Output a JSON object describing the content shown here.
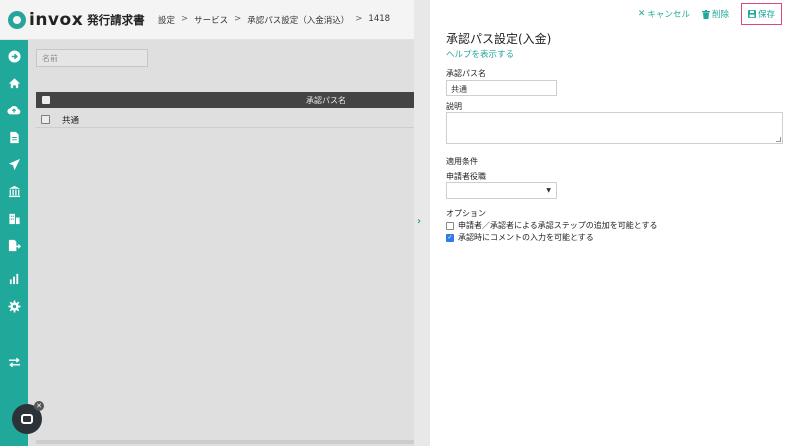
{
  "app": {
    "logo_text": "invox",
    "logo_sub": "発行請求書"
  },
  "breadcrumb": [
    "設定",
    "サービス",
    "承認パス設定（入金消込）",
    "1418"
  ],
  "breadcrumb_sep": ">",
  "sidebar": {
    "icons": [
      "arrow-right-icon",
      "home-icon",
      "cloud-upload-icon",
      "document-icon",
      "send-icon",
      "bank-icon",
      "building-icon",
      "export-icon",
      "chart-icon",
      "gear-icon",
      "transfer-icon"
    ]
  },
  "list": {
    "search_placeholder": "名前",
    "column_header": "承認パス名",
    "rows": [
      {
        "name": "共通"
      }
    ]
  },
  "panel": {
    "actions": {
      "cancel": "キャンセル",
      "delete": "削除",
      "save": "保存"
    },
    "title": "承認パス設定(入金)",
    "help_link": "ヘルプを表示する",
    "name_label": "承認パス名",
    "name_value": "共通",
    "description_label": "説明",
    "description_value": "",
    "conditions_label": "適用条件",
    "role_label": "申請者役職",
    "role_value": "",
    "options_label": "オプション",
    "options": [
      {
        "label": "申請者／承認者による承認ステップの追加を可能とする",
        "checked": false
      },
      {
        "label": "承認時にコメントの入力を可能とする",
        "checked": true
      }
    ]
  },
  "colors": {
    "accent": "#20a89a",
    "save_highlight": "#e0477a",
    "checkbox_on": "#2e7be6"
  }
}
